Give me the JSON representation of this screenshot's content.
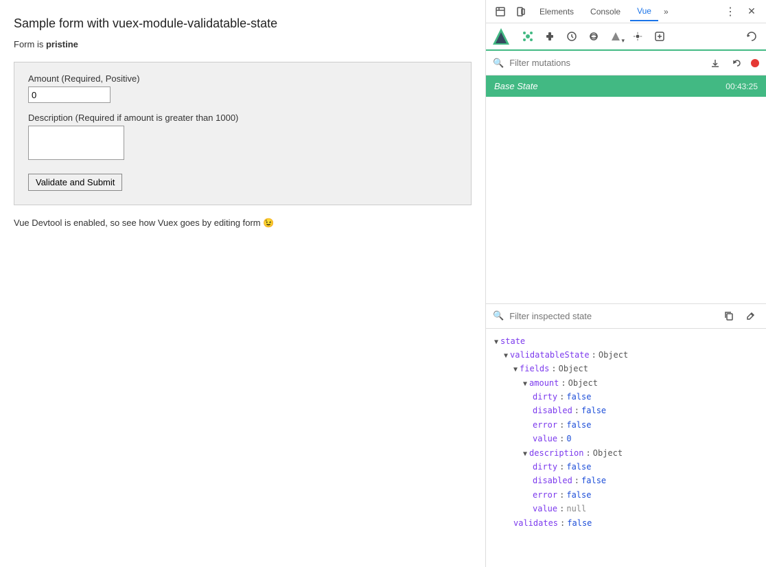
{
  "left": {
    "title": "Sample form with vuex-module-validatable-state",
    "form_status_prefix": "Form is ",
    "form_status_value": "pristine",
    "amount_label": "Amount (Required, Positive)",
    "amount_value": "0",
    "description_label": "Description (Required if amount is greater than 1000)",
    "submit_button": "Validate and Submit",
    "hint": "Vue Devtool is enabled, so see how Vuex goes by editing form 😉"
  },
  "devtools": {
    "tabs": [
      "Elements",
      "Console",
      "Vue"
    ],
    "active_tab": "Vue",
    "more_label": "»",
    "filter_mutations_placeholder": "Filter mutations",
    "base_state_label": "Base State",
    "base_state_time": "00:43:25",
    "filter_inspected_placeholder": "Filter inspected state",
    "state_tree": {
      "state_label": "state",
      "validatable_state_label": "validatableState",
      "validatable_state_type": "Object",
      "fields_label": "fields",
      "fields_type": "Object",
      "amount_label": "amount",
      "amount_type": "Object",
      "amount_dirty_key": "dirty",
      "amount_dirty_val": "false",
      "amount_disabled_key": "disabled",
      "amount_disabled_val": "false",
      "amount_error_key": "error",
      "amount_error_val": "false",
      "amount_value_key": "value",
      "amount_value_val": "0",
      "description_label": "description",
      "description_type": "Object",
      "desc_dirty_key": "dirty",
      "desc_dirty_val": "false",
      "desc_disabled_key": "disabled",
      "desc_disabled_val": "false",
      "desc_error_key": "error",
      "desc_error_val": "false",
      "desc_value_key": "value",
      "desc_value_val": "null",
      "validates_key": "validates",
      "validates_val": "false"
    }
  }
}
